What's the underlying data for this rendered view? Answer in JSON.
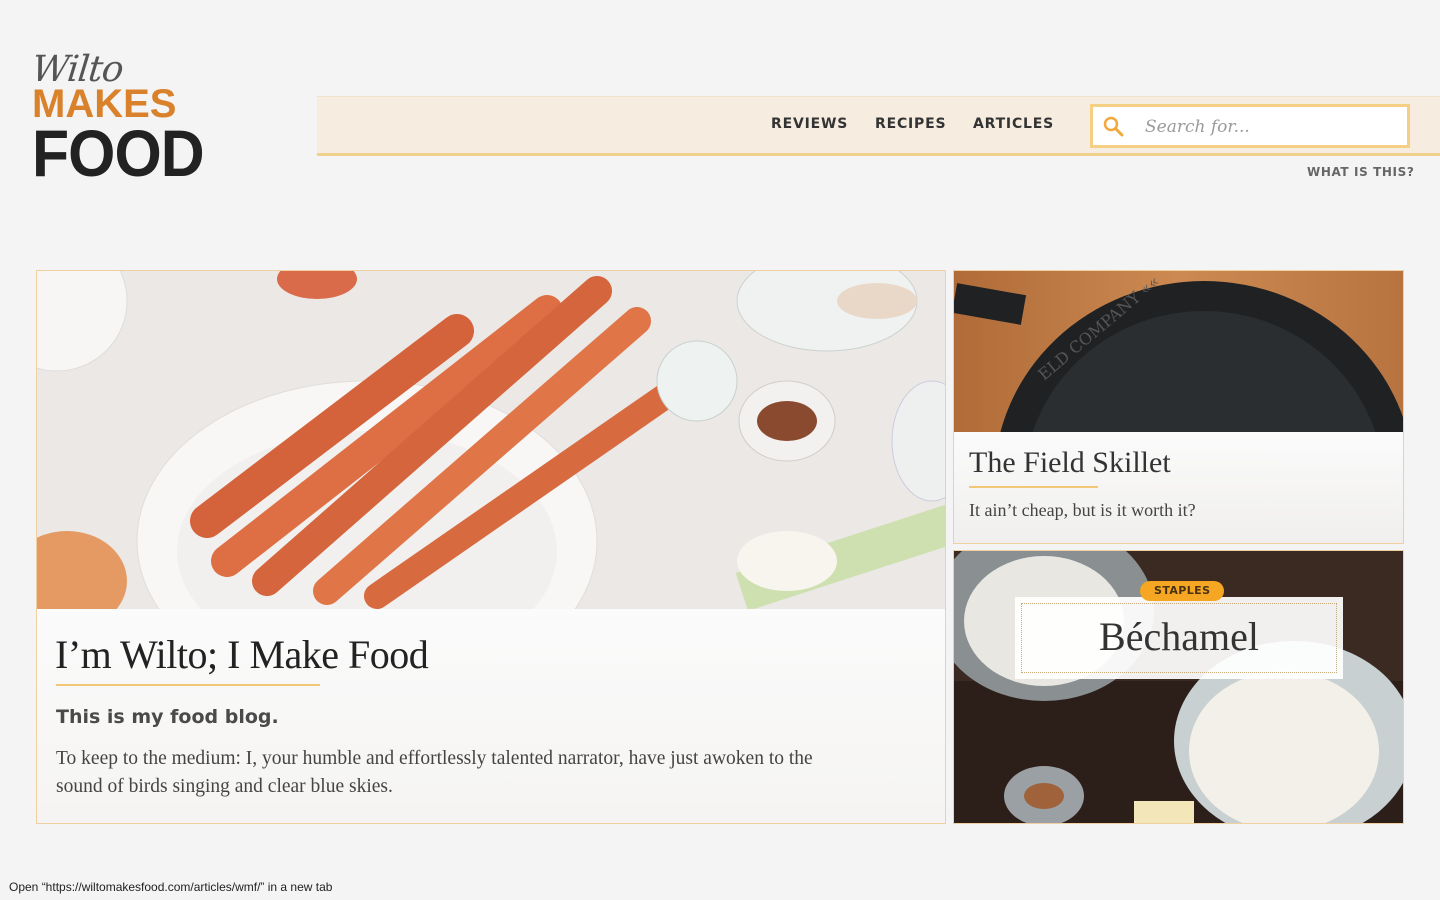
{
  "logo": {
    "script_text": "Wilto",
    "makes_text": "MAKES",
    "food_text": "FOOD",
    "colors": {
      "script": "#555555",
      "makes": "#d9822b",
      "food": "#222222"
    }
  },
  "nav": {
    "items": [
      {
        "label": "REVIEWS"
      },
      {
        "label": "RECIPES"
      },
      {
        "label": "ARTICLES"
      }
    ],
    "search": {
      "placeholder": "Search for...",
      "value": "",
      "icon": "search-icon"
    },
    "what_link": "WHAT IS THIS?"
  },
  "cards": {
    "main": {
      "title": "I’m Wilto; I Make Food",
      "subtitle": "This is my food blog.",
      "body": "To keep to the medium: I, your humble and effortlessly talented narrator, have just awoken to the sound of birds singing and clear blue skies."
    },
    "skillet": {
      "title": "The Field Skillet",
      "subtitle": "It ain’t cheap, but is it worth it?"
    },
    "bechamel": {
      "badge": "STAPLES",
      "title": "Béchamel"
    }
  },
  "status_bar": {
    "text": "Open “https://wiltomakesfood.com/articles/wmf/” in a new tab"
  },
  "colors": {
    "accent": "#f2c777",
    "nav_bg": "#f6ede0",
    "badge": "#f5a623",
    "page_bg": "#f4f4f4"
  }
}
